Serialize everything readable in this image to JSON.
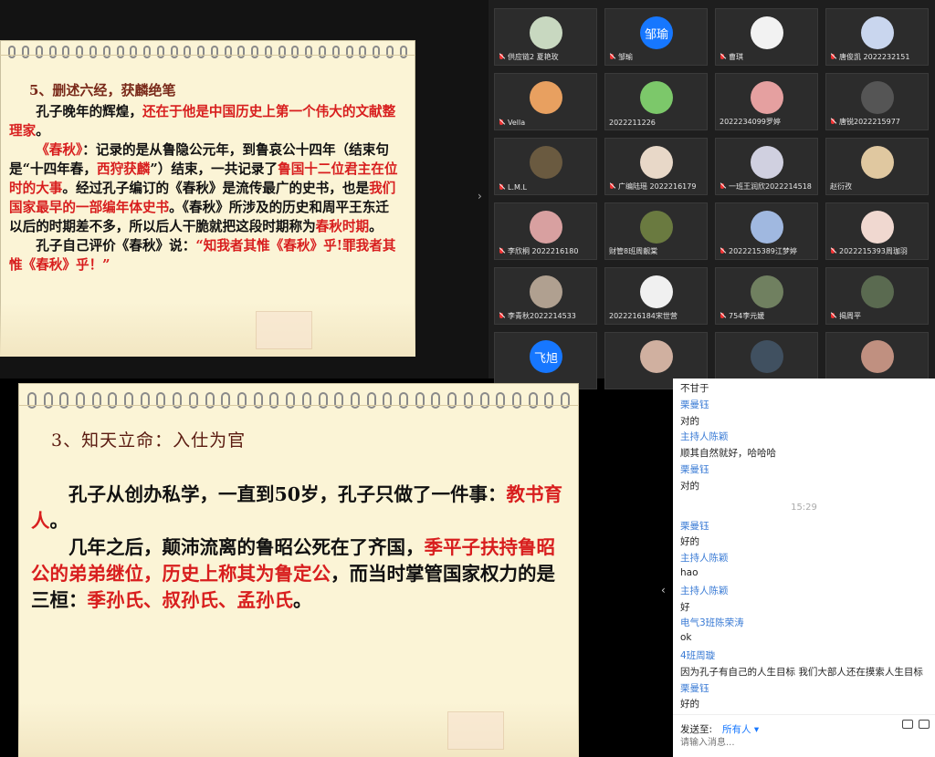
{
  "slide_top": {
    "heading": "5、删述六经，获麟绝笔",
    "p1_a": "孔子晚年的辉煌，",
    "p1_b": "还在于他是中国历史上第一个伟大的文献整理家",
    "p1_c": "。",
    "p2_a": "《春秋》",
    "p2_b": "：记录的是从鲁隐公元年，到鲁哀公十四年（结束句是“十四年春，",
    "p2_c": "西狩获麟",
    "p2_d": "”）结束，一共记录了",
    "p2_e": "鲁国十二位君主在位时的大事",
    "p2_f": "。经过孔子编订的《春秋》是流传最广的史书，也是",
    "p2_g": "我们国家最早的一部编年体史书",
    "p2_h": "。《春秋》所涉及的历史和周平王东迁以后的时期差不多，所以后人干脆就把这段时期称为",
    "p2_i": "春秋时期",
    "p2_j": "。",
    "p3_a": "孔子自己评价《春秋》说：",
    "p3_b": "“知我者其惟《春秋》乎!罪我者其惟《春秋》乎！”"
  },
  "slide_bottom": {
    "heading": "3、知天立命：入仕为官",
    "p1_a": "孔子从创办私学，一直到50岁，孔子只做了一件事：",
    "p1_b": "教书育人",
    "p1_c": "。",
    "p2_a": "几年之后，颠沛流离的鲁昭公死在了齐国，",
    "p2_b": "季平子扶持鲁昭公的弟弟继位，历史上称其为鲁定公",
    "p2_c": "，而当时掌管国家权力的是三桓：",
    "p2_d": "季孙氏、叔孙氏、孟孙氏",
    "p2_e": "。"
  },
  "participants": [
    {
      "name": "供应链2 夏艳玫",
      "avatar_color": "#c8d8c0",
      "muted": true
    },
    {
      "name": "邹瑜",
      "avatar_text": "邹瑜",
      "avatar_color": "#1677ff",
      "muted": true
    },
    {
      "name": "曹琪",
      "avatar_color": "#f2f2f2",
      "muted": true
    },
    {
      "name": "唐俊凯 2022232151",
      "avatar_color": "#c9d6ee",
      "muted": true
    },
    {
      "name": "Vella",
      "avatar_color": "#e8a060",
      "muted": true
    },
    {
      "name": "2022211226",
      "avatar_color": "#7cc86a",
      "muted": false
    },
    {
      "name": "2022234099罗婷",
      "avatar_color": "#e5a0a0",
      "muted": false
    },
    {
      "name": "唐锐2022215977",
      "avatar_color": "#555555",
      "muted": true
    },
    {
      "name": "L.M.L",
      "avatar_color": "#6a5a40",
      "muted": true
    },
    {
      "name": "广编陆瑶 2022216179",
      "avatar_color": "#e8d8c8",
      "muted": true
    },
    {
      "name": "一班王润欣2022214518",
      "avatar_color": "#d0d0e0",
      "muted": true
    },
    {
      "name": "赵衍孜",
      "avatar_color": "#e0c8a0",
      "muted": false
    },
    {
      "name": "李欣桐 2022216180",
      "avatar_color": "#d8a0a0",
      "muted": true
    },
    {
      "name": "财管8班周靓棠",
      "avatar_color": "#6a7a40",
      "muted": false
    },
    {
      "name": "2022215389江梦婷",
      "avatar_color": "#a0b8e0",
      "muted": true
    },
    {
      "name": "2022215393周珈羽",
      "avatar_color": "#f0d8d0",
      "muted": true
    },
    {
      "name": "李青秋2022214533",
      "avatar_color": "#b0a090",
      "muted": true
    },
    {
      "name": "2022216184宋世营",
      "avatar_color": "#f0f0f0",
      "muted": false
    },
    {
      "name": "754李元媛",
      "avatar_color": "#708060",
      "muted": true
    },
    {
      "name": "揭周平",
      "avatar_color": "#5a6a50",
      "muted": true
    },
    {
      "name": "",
      "avatar_text": "飞旭",
      "avatar_color": "#1677ff",
      "muted": false
    },
    {
      "name": "",
      "avatar_color": "#d0b0a0",
      "muted": false
    },
    {
      "name": "",
      "avatar_color": "#405060",
      "muted": false
    },
    {
      "name": "",
      "avatar_color": "#c09080",
      "muted": false
    }
  ],
  "chat": {
    "time_label": "15:29",
    "messages": [
      {
        "kind": "text",
        "text": "不甘于"
      },
      {
        "kind": "sender",
        "text": "栗曼钰"
      },
      {
        "kind": "text",
        "text": "对的"
      },
      {
        "kind": "sender",
        "text": "主持人陈颖"
      },
      {
        "kind": "text",
        "text": "顺其自然就好，哈哈哈"
      },
      {
        "kind": "sender",
        "text": "栗曼钰"
      },
      {
        "kind": "text",
        "text": "对的"
      },
      {
        "kind": "time",
        "text": "15:29"
      },
      {
        "kind": "sender",
        "text": "栗曼钰"
      },
      {
        "kind": "text",
        "text": "好的"
      },
      {
        "kind": "sender",
        "text": "主持人陈颖"
      },
      {
        "kind": "text",
        "text": "hao"
      },
      {
        "kind": "sender",
        "text": "主持人陈颖"
      },
      {
        "kind": "text",
        "text": "好"
      },
      {
        "kind": "sender",
        "text": "电气3班陈荣涛"
      },
      {
        "kind": "text",
        "text": "ok"
      },
      {
        "kind": "sender",
        "text": "4班周璇"
      },
      {
        "kind": "text",
        "text": "因为孔子有自己的人生目标 我们大部人还在摸索人生目标"
      },
      {
        "kind": "sender",
        "text": "栗曼钰"
      },
      {
        "kind": "text",
        "text": "好的"
      }
    ],
    "sendto_label": "发送至:",
    "sendto_value": "所有人 ▾",
    "input_placeholder": "请输入消息..."
  }
}
